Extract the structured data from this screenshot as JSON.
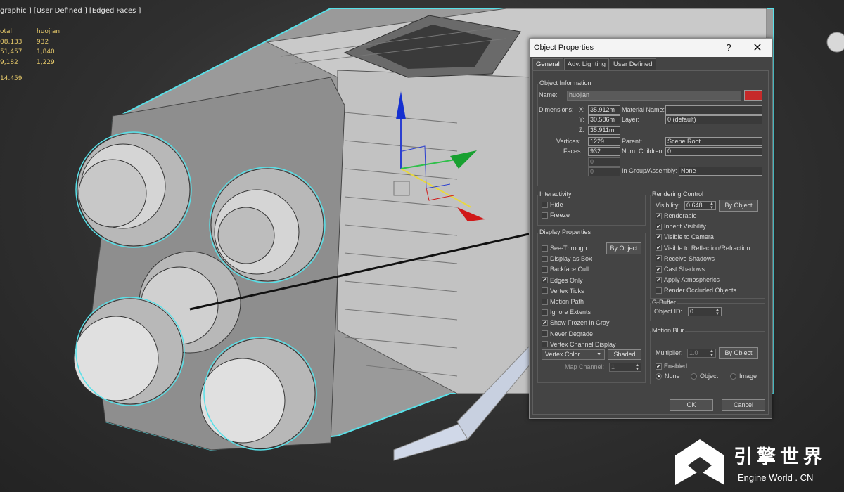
{
  "viewport": {
    "label": "graphic ] [User Defined ] [Edged Faces ]",
    "stats": {
      "col1": [
        "otal",
        "08,133",
        "51,457",
        "9,182"
      ],
      "col2": [
        "huojian",
        "932",
        "1,840",
        "1,229"
      ],
      "extra": "14.459"
    }
  },
  "dialog": {
    "title": "Object Properties",
    "help": "?",
    "close": "✕",
    "tabs": [
      "General",
      "Adv. Lighting",
      "User Defined"
    ],
    "object_info": {
      "group_label": "Object Information",
      "name_label": "Name:",
      "name_value": "huojian",
      "color": "#c62a2a",
      "dims_label": "Dimensions:",
      "x_label": "X:",
      "x_value": "35.912m",
      "y_label": "Y:",
      "y_value": "30.586m",
      "z_label": "Z:",
      "z_value": "35.911m",
      "vertices_label": "Vertices:",
      "vertices_value": "1229",
      "faces_label": "Faces:",
      "faces_value": "932",
      "blank1": "0",
      "blank2": "0",
      "material_label": "Material Name:",
      "material_value": "",
      "layer_label": "Layer:",
      "layer_value": "0 (default)",
      "parent_label": "Parent:",
      "parent_value": "Scene Root",
      "children_label": "Num. Children:",
      "children_value": "0",
      "group_asm_label": "In Group/Assembly:",
      "group_asm_value": "None"
    },
    "interactivity": {
      "group_label": "Interactivity",
      "hide": "Hide",
      "freeze": "Freeze"
    },
    "display": {
      "group_label": "Display Properties",
      "by_object": "By Object",
      "items": [
        "See-Through",
        "Display as Box",
        "Backface Cull",
        "Edges Only",
        "Vertex Ticks",
        "Motion Path",
        "Ignore Extents",
        "Show Frozen in Gray",
        "Never Degrade",
        "Vertex Channel Display"
      ],
      "checked": [
        false,
        false,
        false,
        true,
        false,
        false,
        false,
        true,
        false,
        false
      ],
      "vertex_color": "Vertex Color",
      "shaded": "Shaded",
      "map_channel_label": "Map Channel:",
      "map_channel_value": "1"
    },
    "rendering": {
      "group_label": "Rendering Control",
      "visibility_label": "Visibility:",
      "visibility_value": "0.648",
      "by_object": "By Object",
      "items": [
        "Renderable",
        "Inherit Visibility",
        "Visible to Camera",
        "Visible to Reflection/Refraction",
        "Receive Shadows",
        "Cast Shadows",
        "Apply Atmospherics",
        "Render Occluded Objects"
      ],
      "checked": [
        true,
        true,
        true,
        true,
        true,
        true,
        true,
        false
      ]
    },
    "gbuffer": {
      "group_label": "G-Buffer",
      "object_id_label": "Object ID:",
      "object_id_value": "0"
    },
    "motion_blur": {
      "group_label": "Motion Blur",
      "multiplier_label": "Multiplier:",
      "multiplier_value": "1.0",
      "by_object": "By Object",
      "enabled": "Enabled",
      "none": "None",
      "object": "Object",
      "image": "Image"
    },
    "ok": "OK",
    "cancel": "Cancel"
  },
  "watermark": {
    "cn": "引擎世界",
    "en": "Engine World . CN"
  }
}
